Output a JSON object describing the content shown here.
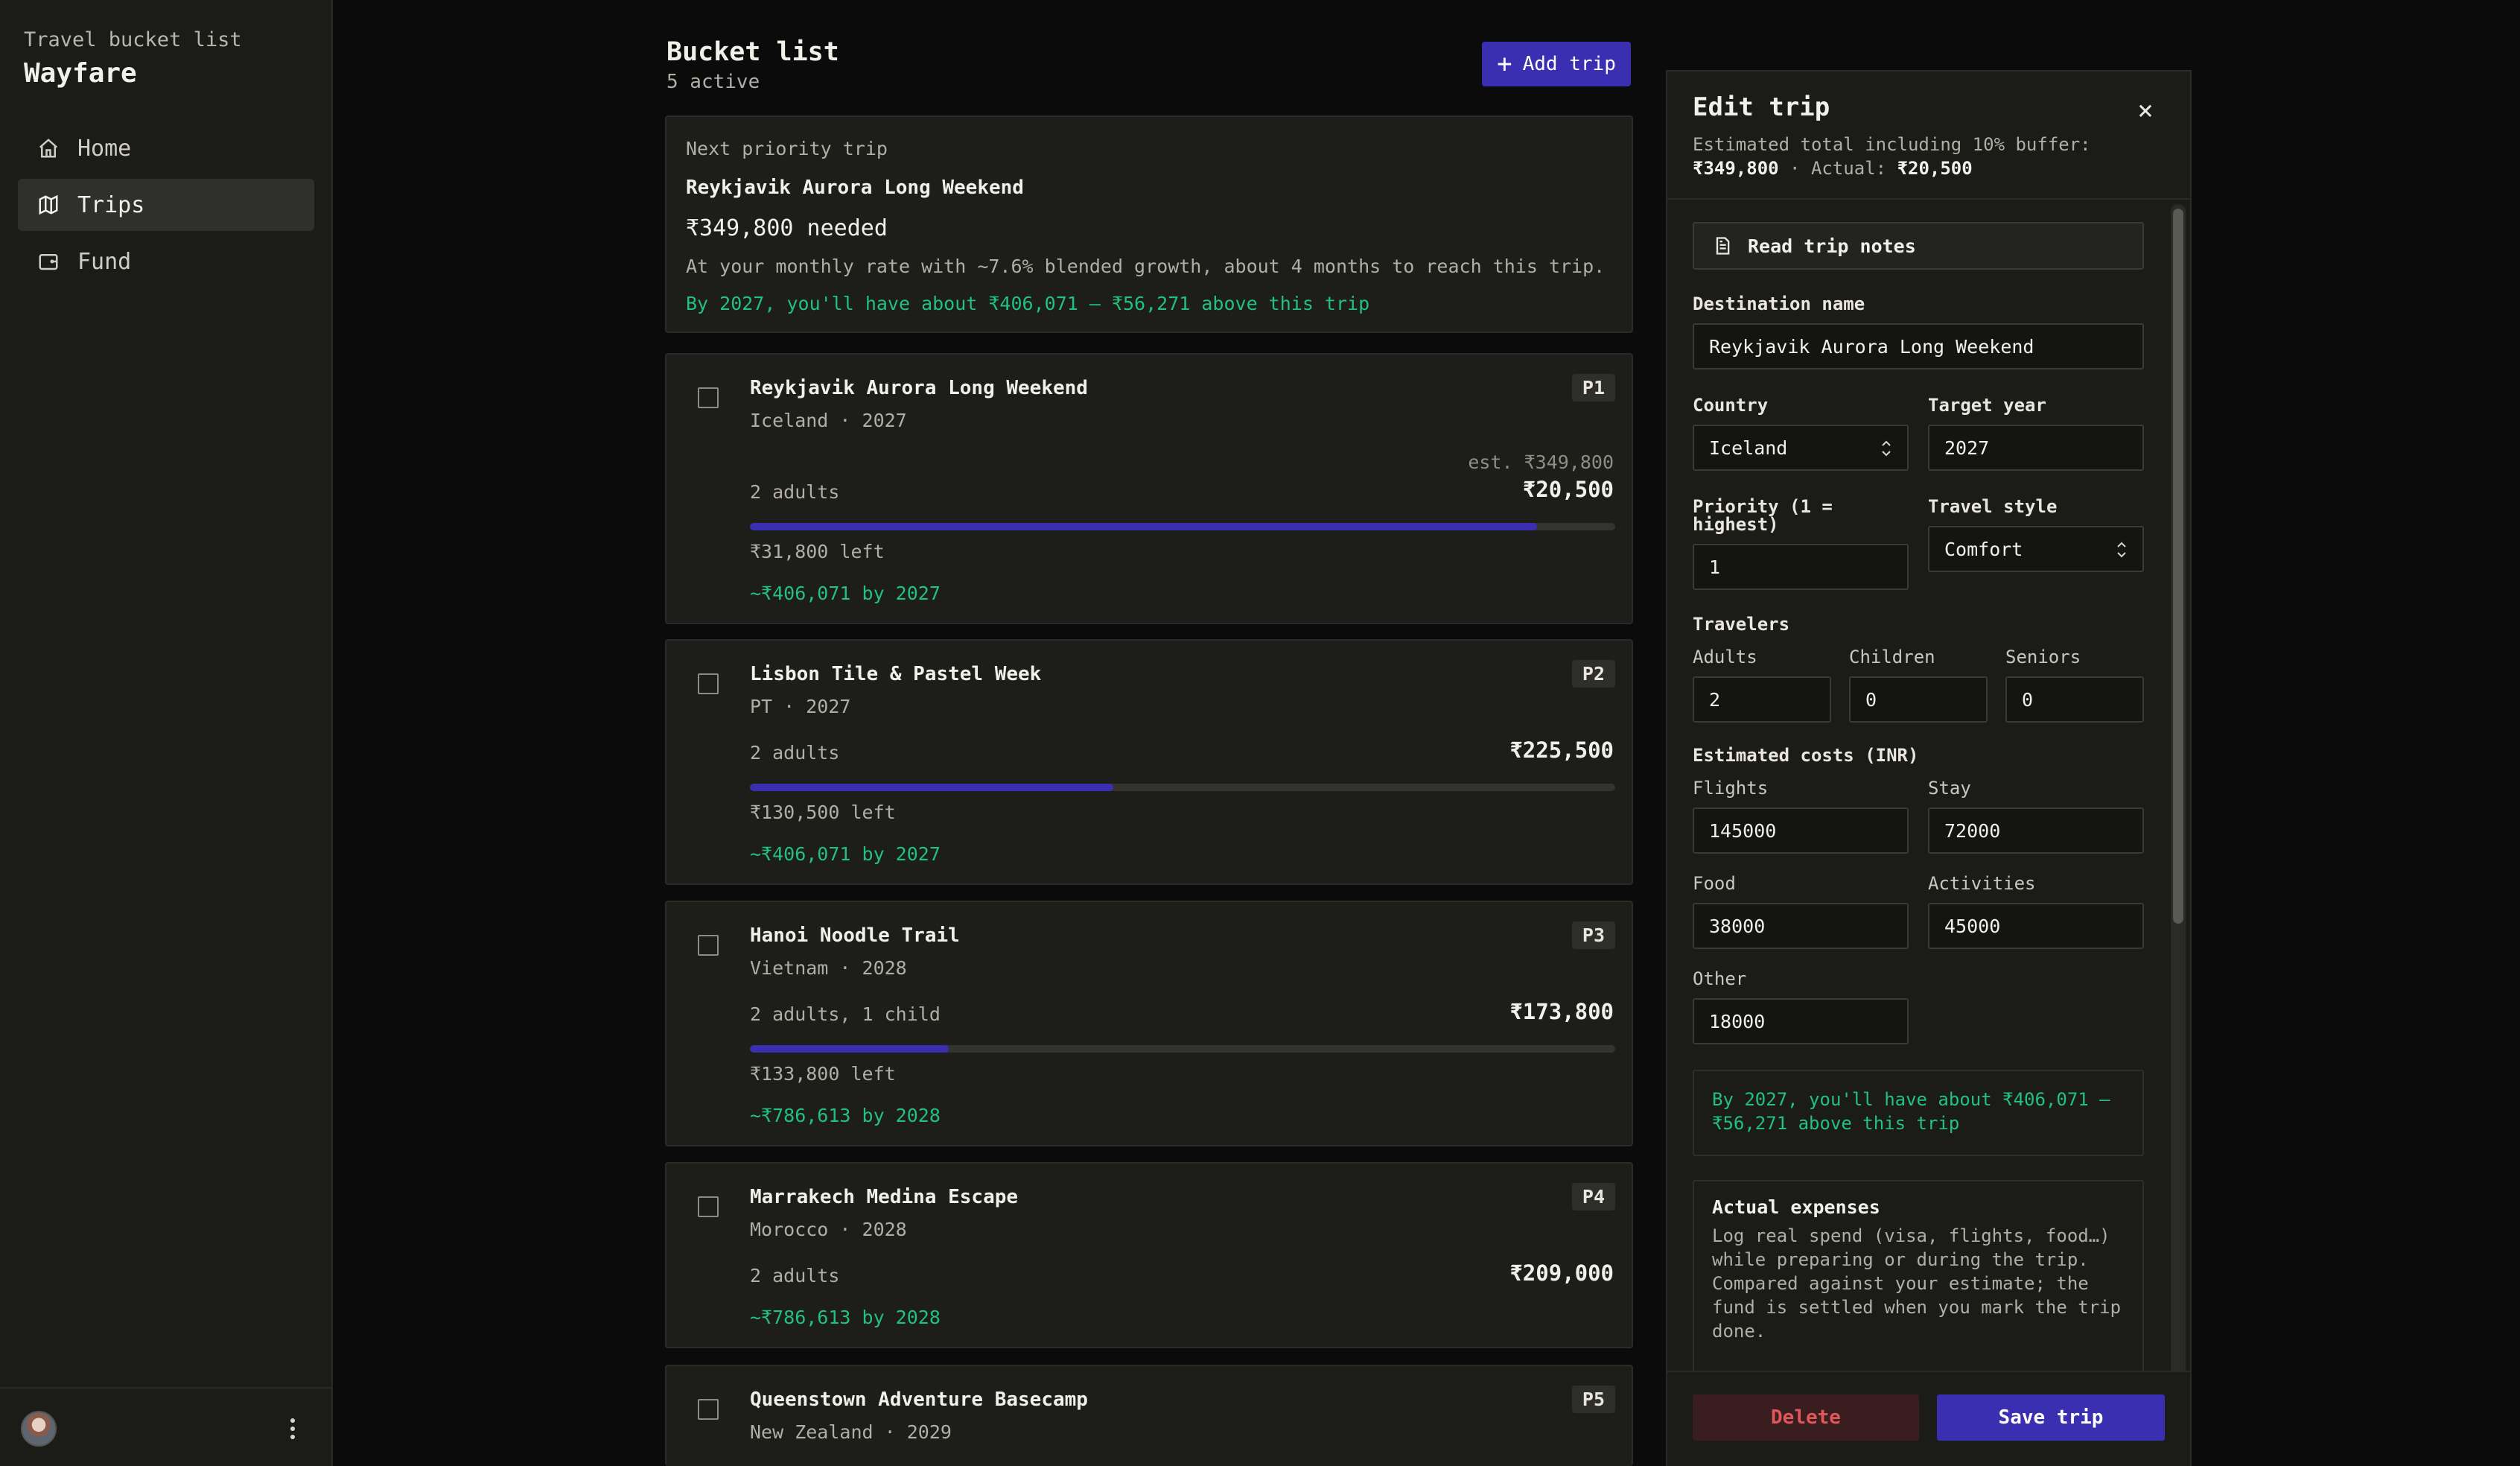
{
  "sidebar": {
    "app_subtitle": "Travel bucket list",
    "app_name": "Wayfare",
    "nav": [
      {
        "label": "Home",
        "icon": "home-icon"
      },
      {
        "label": "Trips",
        "icon": "map-icon"
      },
      {
        "label": "Fund",
        "icon": "wallet-icon"
      }
    ],
    "active_nav": "Trips"
  },
  "header": {
    "title": "Bucket list",
    "subtitle": "5 active",
    "add_button": "Add trip"
  },
  "priority_card": {
    "label": "Next priority trip",
    "trip_name": "Reykjavik Aurora Long Weekend",
    "needed": "₹349,800 needed",
    "rate_note": "At your monthly rate with ~7.6% blended growth, about 4 months to reach this trip.",
    "projection": "By 2027, you'll have about ₹406,071 — ₹56,271 above this trip"
  },
  "trips": [
    {
      "name": "Reykjavik Aurora Long Weekend",
      "meta": "Iceland · 2027",
      "badge": "P1",
      "estimate": "est. ₹349,800",
      "travelers": "2 adults",
      "amount": "₹20,500",
      "progress": 0.91,
      "left": "₹31,800 left",
      "projection": "~₹406,071 by 2027"
    },
    {
      "name": "Lisbon Tile & Pastel Week",
      "meta": "PT · 2027",
      "badge": "P2",
      "estimate": "",
      "travelers": "2 adults",
      "amount": "₹225,500",
      "progress": 0.42,
      "left": "₹130,500 left",
      "projection": "~₹406,071 by 2027"
    },
    {
      "name": "Hanoi Noodle Trail",
      "meta": "Vietnam · 2028",
      "badge": "P3",
      "estimate": "",
      "travelers": "2 adults, 1 child",
      "amount": "₹173,800",
      "progress": 0.23,
      "left": "₹133,800 left",
      "projection": "~₹786,613 by 2028"
    },
    {
      "name": "Marrakech Medina Escape",
      "meta": "Morocco · 2028",
      "badge": "P4",
      "estimate": "",
      "travelers": "2 adults",
      "amount": "₹209,000",
      "progress": null,
      "left": "",
      "projection": "~₹786,613 by 2028"
    },
    {
      "name": "Queenstown Adventure Basecamp",
      "meta": "New Zealand · 2029",
      "badge": "P5",
      "estimate": "",
      "travelers": "",
      "amount": "",
      "progress": null,
      "left": "",
      "projection": ""
    }
  ],
  "edit_panel": {
    "title": "Edit trip",
    "estimate_line": "Estimated total including 10% buffer:",
    "estimate_total": "₹349,800",
    "actual_label": "Actual:",
    "actual_value": "₹20,500",
    "notes_button": "Read trip notes",
    "destination_label": "Destination name",
    "destination_value": "Reykjavik Aurora Long Weekend",
    "country_label": "Country",
    "country_value": "Iceland",
    "year_label": "Target year",
    "year_value": "2027",
    "priority_label": "Priority (1 = highest)",
    "priority_value": "1",
    "style_label": "Travel style",
    "style_value": "Comfort",
    "travelers_label": "Travelers",
    "adults_label": "Adults",
    "adults_value": "2",
    "children_label": "Children",
    "children_value": "0",
    "seniors_label": "Seniors",
    "seniors_value": "0",
    "costs_label": "Estimated costs (INR)",
    "flights_label": "Flights",
    "flights_value": "145000",
    "stay_label": "Stay",
    "stay_value": "72000",
    "food_label": "Food",
    "food_value": "38000",
    "activities_label": "Activities",
    "activities_value": "45000",
    "other_label": "Other",
    "other_value": "18000",
    "projection": "By 2027, you'll have about ₹406,071 — ₹56,271 above this trip",
    "expenses_title": "Actual expenses",
    "expenses_desc": "Log real spend (visa, flights, food…) while preparing or during the trip. Compared against your estimate; the fund is settled when you mark the trip done.",
    "delete_button": "Delete",
    "save_button": "Save trip"
  },
  "colors": {
    "accent": "#3a2fb0",
    "positive": "#22c17f",
    "danger": "#e0565a"
  }
}
